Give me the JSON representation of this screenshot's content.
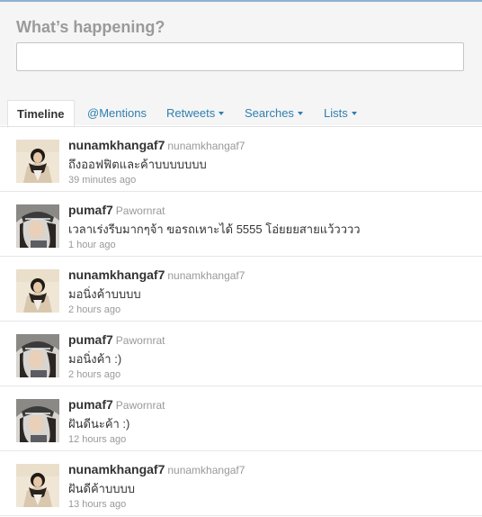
{
  "compose": {
    "title": "What’s happening?",
    "input_value": ""
  },
  "tabs": [
    {
      "label": "Timeline",
      "active": true
    },
    {
      "label": "@Mentions"
    },
    {
      "label": "Retweets",
      "dropdown": true
    },
    {
      "label": "Searches",
      "dropdown": true
    },
    {
      "label": "Lists",
      "dropdown": true
    }
  ],
  "colors": {
    "link": "#2f7fb0",
    "muted": "#999999",
    "header_bg": "#f5f5f5"
  },
  "tweets": [
    {
      "screen_name": "nunamkhangaf7",
      "full_name": "nunamkhangaf7",
      "text": "ถึงออฟฟิตและค้าบบบบบบบ",
      "time": "39 minutes ago",
      "avatar": "avatar-nunam"
    },
    {
      "screen_name": "pumaf7",
      "full_name": "Pawornrat",
      "text": "เวลาเร่งรีบมากๆจ้า ขอรถเหาะได้ 5555 โอ่ยยยสายแว้วววว",
      "time": "1 hour ago",
      "avatar": "avatar-puma"
    },
    {
      "screen_name": "nunamkhangaf7",
      "full_name": "nunamkhangaf7",
      "text": "มอนิ่งค้าบบบบ",
      "time": "2 hours ago",
      "avatar": "avatar-nunam"
    },
    {
      "screen_name": "pumaf7",
      "full_name": "Pawornrat",
      "text": "มอนิ่งค้า :)",
      "time": "2 hours ago",
      "avatar": "avatar-puma"
    },
    {
      "screen_name": "pumaf7",
      "full_name": "Pawornrat",
      "text": "ฝันดีนะค้า :)",
      "time": "12 hours ago",
      "avatar": "avatar-puma"
    },
    {
      "screen_name": "nunamkhangaf7",
      "full_name": "nunamkhangaf7",
      "text": "ฝันดีค้าบบบบ",
      "time": "13 hours ago",
      "avatar": "avatar-nunam"
    }
  ]
}
